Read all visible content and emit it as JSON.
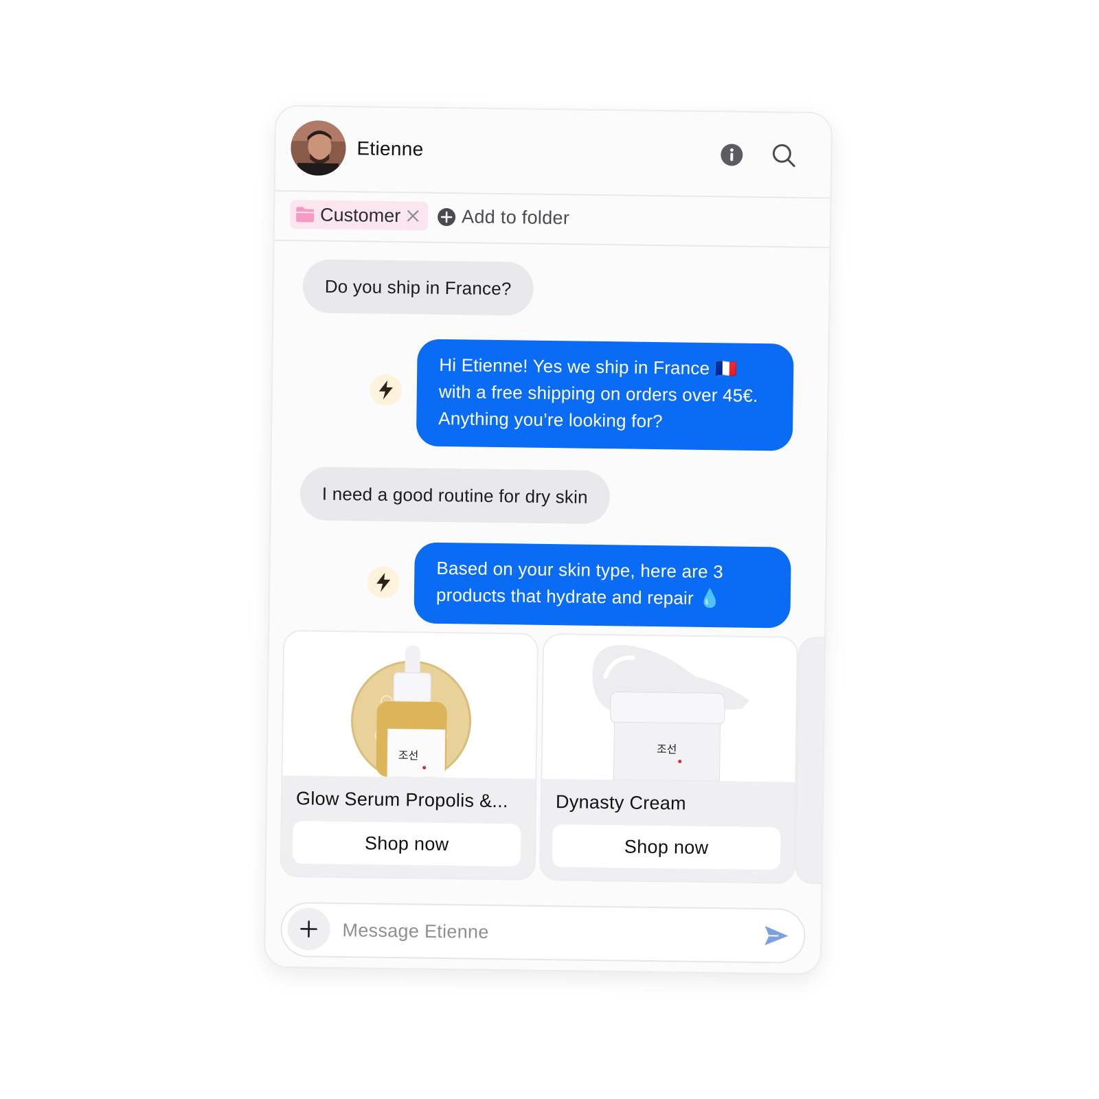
{
  "contact": {
    "name": "Etienne"
  },
  "header_icons": {
    "info": "info-icon",
    "search": "search-icon"
  },
  "folders": {
    "tag_label": "Customer",
    "tag_color": "#fbe6ef",
    "add_label": "Add to folder"
  },
  "messages": [
    {
      "from": "customer",
      "text": "Do you ship in France?"
    },
    {
      "from": "agent",
      "auto": true,
      "text": "Hi Etienne! Yes we ship in France 🇫🇷 with a free shipping on orders over 45€. Anything you’re looking for?"
    },
    {
      "from": "customer",
      "text": "I need a good routine for dry skin"
    },
    {
      "from": "agent",
      "auto": true,
      "text": "Based on your skin type, here are 3 products that hydrate and repair 💧"
    }
  ],
  "products": [
    {
      "name": "Glow Serum Propolis &...",
      "cta": "Shop now"
    },
    {
      "name": "Dynasty Cream",
      "cta": "Shop now"
    }
  ],
  "composer": {
    "placeholder": "Message Etienne"
  },
  "colors": {
    "accent": "#0a6cf5",
    "incoming_bubble": "#e9e9ec",
    "bolt_bg": "#fdf3dc"
  }
}
